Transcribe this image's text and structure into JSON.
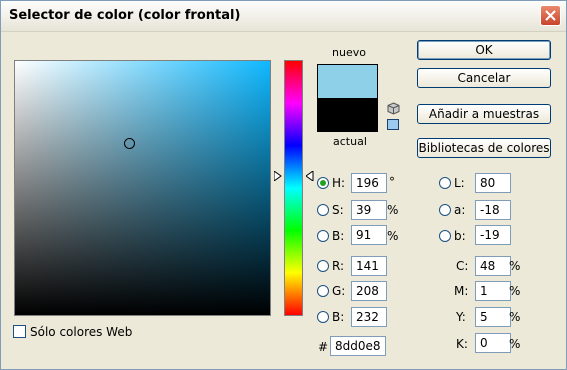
{
  "title": "Selector de color (color frontal)",
  "labels": {
    "new": "nuevo",
    "current": "actual"
  },
  "swatches": {
    "new_color": "#8dd0e8",
    "current_color": "#000000"
  },
  "buttons": {
    "ok": "OK",
    "cancel": "Cancelar",
    "add_swatches": "Añadir a muestras",
    "libraries": "Bibliotecas de colores"
  },
  "hsb": {
    "h": {
      "label": "H:",
      "value": "196",
      "unit": "°"
    },
    "s": {
      "label": "S:",
      "value": "39",
      "unit": "%"
    },
    "b": {
      "label": "B:",
      "value": "91",
      "unit": "%"
    }
  },
  "rgb": {
    "r": {
      "label": "R:",
      "value": "141"
    },
    "g": {
      "label": "G:",
      "value": "208"
    },
    "b": {
      "label": "B:",
      "value": "232"
    }
  },
  "lab": {
    "l": {
      "label": "L:",
      "value": "80"
    },
    "a": {
      "label": "a:",
      "value": "-18"
    },
    "b": {
      "label": "b:",
      "value": "-19"
    }
  },
  "cmyk": {
    "c": {
      "label": "C:",
      "value": "48",
      "unit": "%"
    },
    "m": {
      "label": "M:",
      "value": "1",
      "unit": "%"
    },
    "y": {
      "label": "Y:",
      "value": "5",
      "unit": "%"
    },
    "k": {
      "label": "K:",
      "value": "0",
      "unit": "%"
    }
  },
  "hex": {
    "label": "#",
    "value": "8dd0e8"
  },
  "web_only": {
    "label": "Sólo colores Web",
    "checked": false
  },
  "selected_mode": "H",
  "icons": {
    "close": "close-icon",
    "gamut_cube": "cube-icon",
    "web_safe": "web-safe-swatch-icon"
  }
}
